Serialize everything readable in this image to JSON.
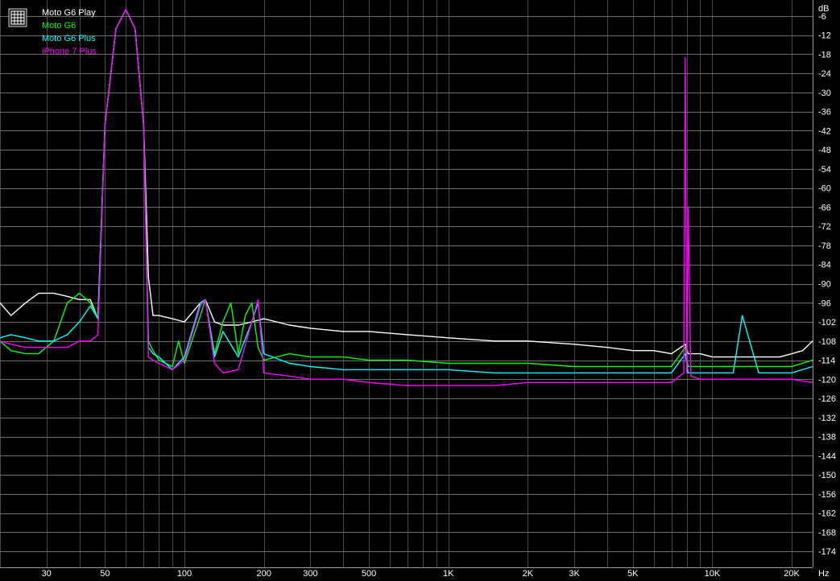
{
  "chart_data": {
    "type": "line",
    "title": "",
    "x_unit": "Hz",
    "y_unit": "dB",
    "x_scale": "log",
    "xlim": [
      20,
      24000
    ],
    "ylim": [
      -179,
      -1
    ],
    "grid": true,
    "legend_placement": "top-left",
    "background": "#000000",
    "grid_color": "#808080",
    "x_tick_labels": [
      {
        "value": 30,
        "label": "30"
      },
      {
        "value": 50,
        "label": "50"
      },
      {
        "value": 100,
        "label": "100"
      },
      {
        "value": 200,
        "label": "200"
      },
      {
        "value": 300,
        "label": "300"
      },
      {
        "value": 500,
        "label": "500"
      },
      {
        "value": 1000,
        "label": "1K"
      },
      {
        "value": 2000,
        "label": "2K"
      },
      {
        "value": 3000,
        "label": "3K"
      },
      {
        "value": 5000,
        "label": "5K"
      },
      {
        "value": 10000,
        "label": "10K"
      },
      {
        "value": 20000,
        "label": "20K"
      }
    ],
    "y_ticks": [
      -6,
      -12,
      -18,
      -24,
      -30,
      -36,
      -42,
      -48,
      -54,
      -60,
      -66,
      -72,
      -78,
      -84,
      -90,
      -96,
      -102,
      -108,
      -114,
      -120,
      -126,
      -132,
      -138,
      -144,
      -150,
      -156,
      -162,
      -168,
      -174
    ],
    "series": [
      {
        "name": "Moto G6 Play",
        "color": "#ffffff",
        "x": [
          20,
          22,
          25,
          28,
          32,
          36,
          40,
          44,
          47,
          50,
          55,
          60,
          65,
          70,
          73,
          76,
          80,
          90,
          100,
          115,
          120,
          130,
          140,
          160,
          180,
          200,
          250,
          300,
          400,
          500,
          700,
          1000,
          1500,
          2000,
          3000,
          4000,
          5000,
          6000,
          7000,
          7900,
          8100,
          9000,
          10000,
          12000,
          15000,
          18000,
          20000,
          22000,
          24000
        ],
        "y": [
          -96,
          -100,
          -96,
          -93,
          -93,
          -94,
          -95,
          -95,
          -101,
          -40,
          -10,
          -4,
          -10,
          -40,
          -88,
          -100,
          -100,
          -101,
          -102,
          -96,
          -95,
          -102,
          -103,
          -103,
          -102,
          -101,
          -103,
          -104,
          -105,
          -105,
          -106,
          -107,
          -108,
          -108,
          -109,
          -110,
          -111,
          -111,
          -112,
          -109,
          -112,
          -112,
          -113,
          -113,
          -113,
          -113,
          -112,
          -111,
          -108
        ]
      },
      {
        "name": "Moto G6",
        "color": "#00ff00",
        "x": [
          20,
          22,
          25,
          28,
          32,
          36,
          40,
          44,
          47,
          50,
          55,
          60,
          65,
          70,
          73,
          76,
          80,
          90,
          95,
          100,
          115,
          120,
          130,
          140,
          150,
          160,
          170,
          180,
          190,
          200,
          250,
          300,
          400,
          500,
          700,
          1000,
          1500,
          2000,
          3000,
          4000,
          5000,
          7000,
          7900,
          8100,
          10000,
          15000,
          20000,
          24000
        ],
        "y": [
          -108,
          -111,
          -112,
          -112,
          -108,
          -96,
          -93,
          -96,
          -101,
          -40,
          -10,
          -4,
          -10,
          -40,
          -108,
          -111,
          -114,
          -116,
          -108,
          -115,
          -100,
          -95,
          -112,
          -102,
          -96,
          -112,
          -100,
          -96,
          -110,
          -114,
          -112,
          -113,
          -113,
          -114,
          -114,
          -115,
          -115,
          -115,
          -116,
          -116,
          -116,
          -116,
          -110,
          -116,
          -116,
          -116,
          -116,
          -114
        ]
      },
      {
        "name": "Moto G6 Plus",
        "color": "#00ffff",
        "x": [
          20,
          22,
          25,
          28,
          32,
          36,
          40,
          44,
          47,
          50,
          55,
          60,
          65,
          70,
          73,
          76,
          80,
          90,
          100,
          115,
          120,
          130,
          140,
          160,
          180,
          190,
          200,
          250,
          300,
          400,
          500,
          700,
          1000,
          1500,
          2000,
          3000,
          4000,
          5000,
          7000,
          7900,
          8100,
          10000,
          12000,
          13000,
          15000,
          20000,
          24000
        ],
        "y": [
          -107,
          -106,
          -107,
          -108,
          -108,
          -106,
          -102,
          -97,
          -101,
          -40,
          -10,
          -4,
          -10,
          -40,
          -110,
          -112,
          -113,
          -117,
          -113,
          -96,
          -95,
          -113,
          -105,
          -113,
          -102,
          -96,
          -112,
          -115,
          -116,
          -117,
          -117,
          -117,
          -117,
          -118,
          -118,
          -118,
          -118,
          -118,
          -118,
          -112,
          -118,
          -118,
          -118,
          -100,
          -118,
          -118,
          -116
        ]
      },
      {
        "name": "iPhone 7 Plus",
        "color": "#ff00ff",
        "x": [
          20,
          22,
          25,
          28,
          32,
          36,
          40,
          44,
          47,
          50,
          55,
          60,
          65,
          70,
          73,
          76,
          80,
          90,
          100,
          115,
          120,
          130,
          140,
          160,
          180,
          190,
          200,
          250,
          300,
          400,
          500,
          700,
          1000,
          1500,
          2000,
          3000,
          4000,
          5000,
          6000,
          7000,
          7800,
          7900,
          8000,
          8100,
          8300,
          9000,
          10000,
          12000,
          15000,
          20000,
          24000
        ],
        "y": [
          -108,
          -109,
          -110,
          -110,
          -110,
          -110,
          -108,
          -108,
          -106,
          -40,
          -10,
          -4,
          -10,
          -40,
          -113,
          -114,
          -115,
          -117,
          -114,
          -97,
          -95,
          -115,
          -118,
          -117,
          -102,
          -95,
          -118,
          -119,
          -120,
          -120,
          -121,
          -122,
          -122,
          -122,
          -121,
          -121,
          -121,
          -121,
          -121,
          -121,
          -118,
          -19,
          -118,
          -66,
          -119,
          -120,
          -120,
          -120,
          -120,
          -120,
          -121
        ]
      }
    ]
  }
}
